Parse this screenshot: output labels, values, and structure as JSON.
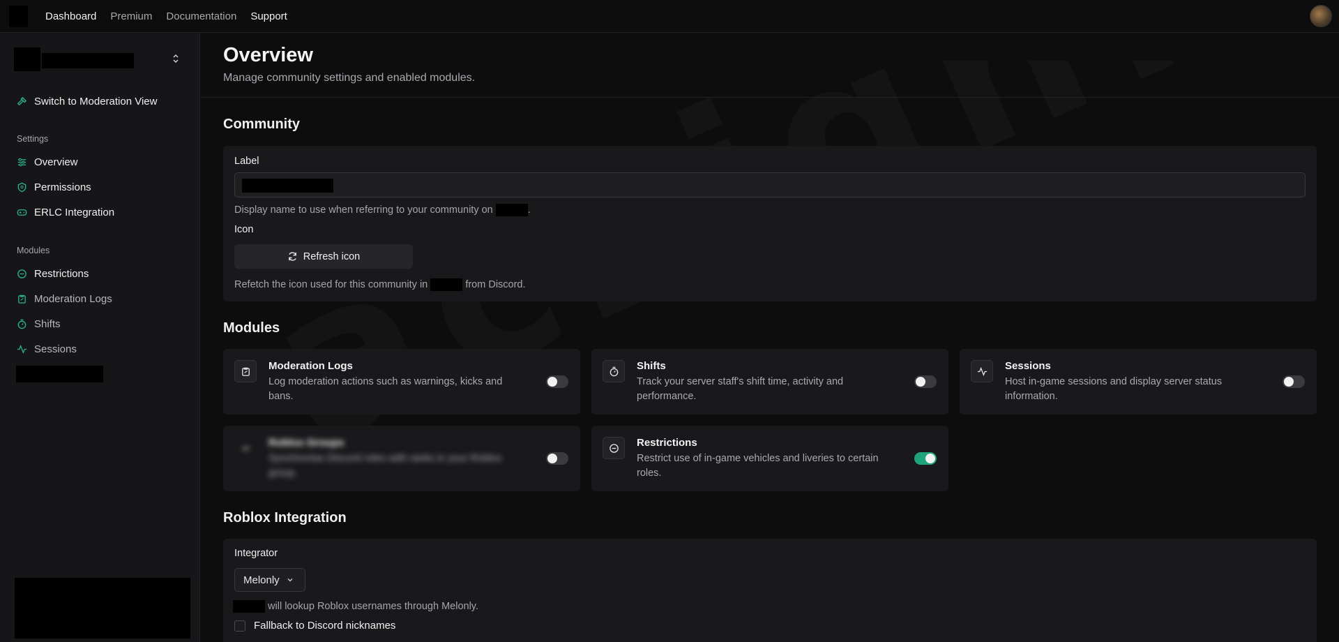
{
  "nav": {
    "links": [
      "Dashboard",
      "Premium",
      "Documentation",
      "Support"
    ],
    "active": "Dashboard"
  },
  "sidebar": {
    "switch_view": "Switch to Moderation View",
    "settings_label": "Settings",
    "settings_items": [
      "Overview",
      "Permissions",
      "ERLC Integration"
    ],
    "modules_label": "Modules",
    "module_items": [
      "Restrictions",
      "Moderation Logs",
      "Shifts",
      "Sessions"
    ],
    "accent": "#2bb58a"
  },
  "page": {
    "title": "Overview",
    "subtitle": "Manage community settings and enabled modules."
  },
  "community": {
    "title": "Community",
    "label_field": "Label",
    "label_hint_prefix": "Display name to use when referring to your community on",
    "label_hint_suffix": ".",
    "icon_field": "Icon",
    "refresh_button": "Refresh icon",
    "icon_hint_prefix": "Refetch the icon used for this community in",
    "icon_hint_suffix": "from Discord."
  },
  "modules": {
    "title": "Modules",
    "cards": [
      {
        "title": "Moderation Logs",
        "desc": "Log moderation actions such as warnings, kicks and bans.",
        "enabled": false,
        "icon": "clipboard-icon"
      },
      {
        "title": "Shifts",
        "desc": "Track your server staff's shift time, activity and performance.",
        "enabled": false,
        "icon": "timer-icon"
      },
      {
        "title": "Sessions",
        "desc": "Host in-game sessions and display server status information.",
        "enabled": false,
        "icon": "activity-icon"
      },
      {
        "title": "Roblox Groups",
        "desc": "Synchronise Discord roles with ranks in your Roblox group.",
        "enabled": false,
        "icon": "link-icon"
      },
      {
        "title": "Restrictions",
        "desc": "Restrict use of in-game vehicles and liveries to certain roles.",
        "enabled": true,
        "icon": "minus-circle-icon"
      }
    ]
  },
  "roblox": {
    "title": "Roblox Integration",
    "integrator_label": "Integrator",
    "integrator_value": "Melonly",
    "hint_suffix": "will lookup Roblox usernames through Melonly.",
    "fallback_label": "Fallback to Discord nicknames"
  }
}
